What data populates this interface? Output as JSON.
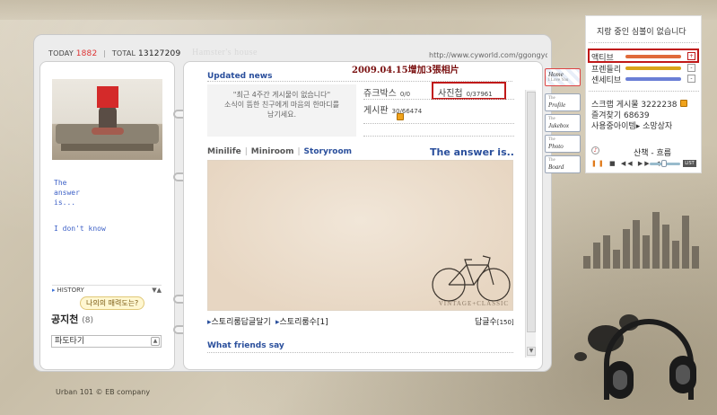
{
  "visit": {
    "today_label": "TODAY",
    "today_value": "1882",
    "separator": "|",
    "total_label": "TOTAL",
    "total_value": "13127209"
  },
  "header": {
    "title": "Hamster's house",
    "url": "http://www.cyworld.com/ggongyoo"
  },
  "annotation": "2009.04.15增加3張相片",
  "profile": {
    "quote_lines": [
      "The",
      "answer",
      "is...",
      "I don't know"
    ],
    "history_label": "HISTORY",
    "history_bubble": "나의의 매력도는?",
    "notice_title": "공지천",
    "notice_count": "(8)",
    "select_value": "파도타기"
  },
  "updated": {
    "title": "Updated news",
    "empty_message": [
      "\"최근 4주간 게시물이 없습니다\"",
      "소식이 뜸한 친구에게 마음의 한마디를",
      "남기세요."
    ],
    "jukebox_label": "쥬크박스",
    "jukebox_value": "0/0",
    "photo_label": "사진첩",
    "photo_value": "0/37961",
    "board_label": "게시판",
    "board_value": "30/66474"
  },
  "room": {
    "tabs": [
      "Minilife",
      "Miniroom",
      "Storyroom"
    ],
    "active_tab": 2,
    "title": "The answer is..",
    "vintage_text": "VINTAGE+CLASSIC",
    "reply_link": "스토리룸답글달기",
    "story_count_link": "스토리룸수",
    "story_count": "[1]",
    "reply_count_label": "답글수",
    "reply_count": "[150]"
  },
  "friends": {
    "title": "What friends say"
  },
  "menu": {
    "tabs": [
      {
        "label": "Home",
        "sub": "I Love You"
      },
      {
        "label": "Profile",
        "sub": "The"
      },
      {
        "label": "Jukebox",
        "sub": "The"
      },
      {
        "label": "Photo",
        "sub": "The"
      },
      {
        "label": "Board",
        "sub": "The"
      }
    ]
  },
  "bgm": {
    "status": "지랑 중인 심볼이 없습니다",
    "moods": [
      {
        "label": "액티브",
        "color": "#e06a3a",
        "btn": "+"
      },
      {
        "label": "프렌들리",
        "color": "#d9a31a",
        "btn": "-"
      },
      {
        "label": "센세티브",
        "color": "#6a7fd6",
        "btn": "-"
      }
    ],
    "scrap_label": "스크랩 게시물",
    "scrap_value": "3222238",
    "fav_label": "즐겨찾기",
    "fav_value": "68639",
    "items_label": "사용중아이템",
    "shop_label": "소망상자",
    "track_title": "산책 - 흐름",
    "list_label": "LIST"
  },
  "footer": {
    "text": "Urban 101 © EB company"
  },
  "colors": {
    "accent_blue": "#2a4f9c",
    "highlight_red": "#c01818",
    "today_red": "#d33"
  }
}
